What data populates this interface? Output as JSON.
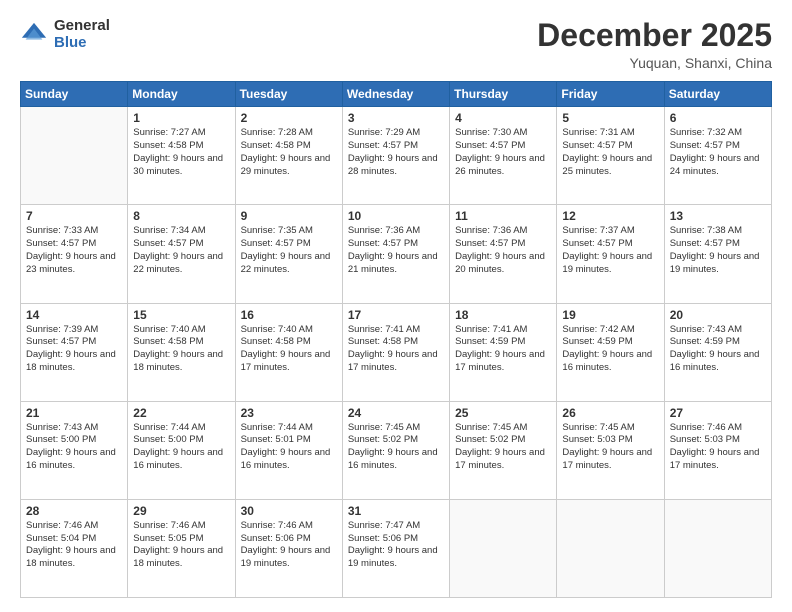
{
  "header": {
    "logo_general": "General",
    "logo_blue": "Blue",
    "month_title": "December 2025",
    "subtitle": "Yuquan, Shanxi, China"
  },
  "days_of_week": [
    "Sunday",
    "Monday",
    "Tuesday",
    "Wednesday",
    "Thursday",
    "Friday",
    "Saturday"
  ],
  "weeks": [
    [
      {
        "day": "",
        "sunrise": "",
        "sunset": "",
        "daylight": "",
        "empty": true
      },
      {
        "day": "1",
        "sunrise": "Sunrise: 7:27 AM",
        "sunset": "Sunset: 4:58 PM",
        "daylight": "Daylight: 9 hours and 30 minutes."
      },
      {
        "day": "2",
        "sunrise": "Sunrise: 7:28 AM",
        "sunset": "Sunset: 4:58 PM",
        "daylight": "Daylight: 9 hours and 29 minutes."
      },
      {
        "day": "3",
        "sunrise": "Sunrise: 7:29 AM",
        "sunset": "Sunset: 4:57 PM",
        "daylight": "Daylight: 9 hours and 28 minutes."
      },
      {
        "day": "4",
        "sunrise": "Sunrise: 7:30 AM",
        "sunset": "Sunset: 4:57 PM",
        "daylight": "Daylight: 9 hours and 26 minutes."
      },
      {
        "day": "5",
        "sunrise": "Sunrise: 7:31 AM",
        "sunset": "Sunset: 4:57 PM",
        "daylight": "Daylight: 9 hours and 25 minutes."
      },
      {
        "day": "6",
        "sunrise": "Sunrise: 7:32 AM",
        "sunset": "Sunset: 4:57 PM",
        "daylight": "Daylight: 9 hours and 24 minutes."
      }
    ],
    [
      {
        "day": "7",
        "sunrise": "Sunrise: 7:33 AM",
        "sunset": "Sunset: 4:57 PM",
        "daylight": "Daylight: 9 hours and 23 minutes."
      },
      {
        "day": "8",
        "sunrise": "Sunrise: 7:34 AM",
        "sunset": "Sunset: 4:57 PM",
        "daylight": "Daylight: 9 hours and 22 minutes."
      },
      {
        "day": "9",
        "sunrise": "Sunrise: 7:35 AM",
        "sunset": "Sunset: 4:57 PM",
        "daylight": "Daylight: 9 hours and 22 minutes."
      },
      {
        "day": "10",
        "sunrise": "Sunrise: 7:36 AM",
        "sunset": "Sunset: 4:57 PM",
        "daylight": "Daylight: 9 hours and 21 minutes."
      },
      {
        "day": "11",
        "sunrise": "Sunrise: 7:36 AM",
        "sunset": "Sunset: 4:57 PM",
        "daylight": "Daylight: 9 hours and 20 minutes."
      },
      {
        "day": "12",
        "sunrise": "Sunrise: 7:37 AM",
        "sunset": "Sunset: 4:57 PM",
        "daylight": "Daylight: 9 hours and 19 minutes."
      },
      {
        "day": "13",
        "sunrise": "Sunrise: 7:38 AM",
        "sunset": "Sunset: 4:57 PM",
        "daylight": "Daylight: 9 hours and 19 minutes."
      }
    ],
    [
      {
        "day": "14",
        "sunrise": "Sunrise: 7:39 AM",
        "sunset": "Sunset: 4:57 PM",
        "daylight": "Daylight: 9 hours and 18 minutes."
      },
      {
        "day": "15",
        "sunrise": "Sunrise: 7:40 AM",
        "sunset": "Sunset: 4:58 PM",
        "daylight": "Daylight: 9 hours and 18 minutes."
      },
      {
        "day": "16",
        "sunrise": "Sunrise: 7:40 AM",
        "sunset": "Sunset: 4:58 PM",
        "daylight": "Daylight: 9 hours and 17 minutes."
      },
      {
        "day": "17",
        "sunrise": "Sunrise: 7:41 AM",
        "sunset": "Sunset: 4:58 PM",
        "daylight": "Daylight: 9 hours and 17 minutes."
      },
      {
        "day": "18",
        "sunrise": "Sunrise: 7:41 AM",
        "sunset": "Sunset: 4:59 PM",
        "daylight": "Daylight: 9 hours and 17 minutes."
      },
      {
        "day": "19",
        "sunrise": "Sunrise: 7:42 AM",
        "sunset": "Sunset: 4:59 PM",
        "daylight": "Daylight: 9 hours and 16 minutes."
      },
      {
        "day": "20",
        "sunrise": "Sunrise: 7:43 AM",
        "sunset": "Sunset: 4:59 PM",
        "daylight": "Daylight: 9 hours and 16 minutes."
      }
    ],
    [
      {
        "day": "21",
        "sunrise": "Sunrise: 7:43 AM",
        "sunset": "Sunset: 5:00 PM",
        "daylight": "Daylight: 9 hours and 16 minutes."
      },
      {
        "day": "22",
        "sunrise": "Sunrise: 7:44 AM",
        "sunset": "Sunset: 5:00 PM",
        "daylight": "Daylight: 9 hours and 16 minutes."
      },
      {
        "day": "23",
        "sunrise": "Sunrise: 7:44 AM",
        "sunset": "Sunset: 5:01 PM",
        "daylight": "Daylight: 9 hours and 16 minutes."
      },
      {
        "day": "24",
        "sunrise": "Sunrise: 7:45 AM",
        "sunset": "Sunset: 5:02 PM",
        "daylight": "Daylight: 9 hours and 16 minutes."
      },
      {
        "day": "25",
        "sunrise": "Sunrise: 7:45 AM",
        "sunset": "Sunset: 5:02 PM",
        "daylight": "Daylight: 9 hours and 17 minutes."
      },
      {
        "day": "26",
        "sunrise": "Sunrise: 7:45 AM",
        "sunset": "Sunset: 5:03 PM",
        "daylight": "Daylight: 9 hours and 17 minutes."
      },
      {
        "day": "27",
        "sunrise": "Sunrise: 7:46 AM",
        "sunset": "Sunset: 5:03 PM",
        "daylight": "Daylight: 9 hours and 17 minutes."
      }
    ],
    [
      {
        "day": "28",
        "sunrise": "Sunrise: 7:46 AM",
        "sunset": "Sunset: 5:04 PM",
        "daylight": "Daylight: 9 hours and 18 minutes."
      },
      {
        "day": "29",
        "sunrise": "Sunrise: 7:46 AM",
        "sunset": "Sunset: 5:05 PM",
        "daylight": "Daylight: 9 hours and 18 minutes."
      },
      {
        "day": "30",
        "sunrise": "Sunrise: 7:46 AM",
        "sunset": "Sunset: 5:06 PM",
        "daylight": "Daylight: 9 hours and 19 minutes."
      },
      {
        "day": "31",
        "sunrise": "Sunrise: 7:47 AM",
        "sunset": "Sunset: 5:06 PM",
        "daylight": "Daylight: 9 hours and 19 minutes."
      },
      {
        "day": "",
        "sunrise": "",
        "sunset": "",
        "daylight": "",
        "empty": true
      },
      {
        "day": "",
        "sunrise": "",
        "sunset": "",
        "daylight": "",
        "empty": true
      },
      {
        "day": "",
        "sunrise": "",
        "sunset": "",
        "daylight": "",
        "empty": true
      }
    ]
  ]
}
